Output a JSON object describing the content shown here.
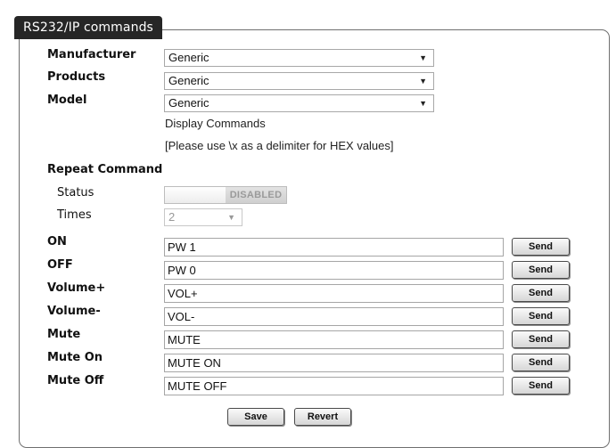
{
  "panel": {
    "title": "RS232/IP commands"
  },
  "manufacturer": {
    "label": "Manufacturer",
    "value": "Generic"
  },
  "products": {
    "label": "Products",
    "value": "Generic"
  },
  "model": {
    "label": "Model",
    "value": "Generic"
  },
  "display_commands": "Display Commands",
  "hex_note": "[Please use \\x as a delimiter for HEX values]",
  "repeat": {
    "label": "Repeat Command",
    "status_label": "Status",
    "status_value": "DISABLED",
    "times_label": "Times",
    "times_value": "2"
  },
  "commands": [
    {
      "label": "ON",
      "value": "PW 1"
    },
    {
      "label": "OFF",
      "value": "PW 0"
    },
    {
      "label": "Volume+",
      "value": "VOL+"
    },
    {
      "label": "Volume-",
      "value": "VOL-"
    },
    {
      "label": "Mute",
      "value": "MUTE"
    },
    {
      "label": "Mute On",
      "value": "MUTE ON"
    },
    {
      "label": "Mute Off",
      "value": "MUTE OFF"
    }
  ],
  "send_label": "Send",
  "footer": {
    "save_label": "Save",
    "revert_label": "Revert"
  },
  "icons": {
    "dropdown": "chevron-down-icon"
  }
}
